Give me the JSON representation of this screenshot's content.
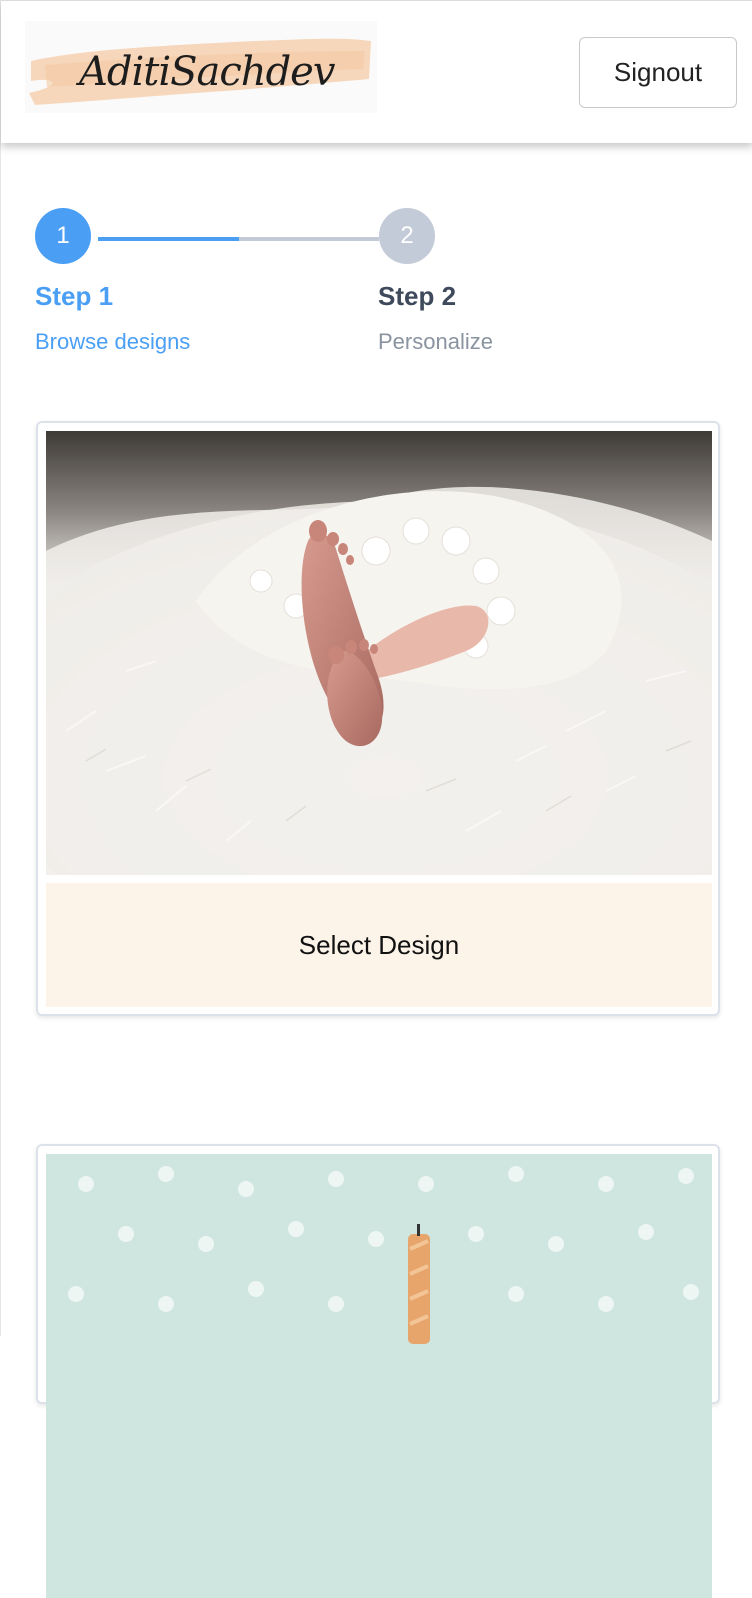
{
  "header": {
    "logo_text": "AditiSachdev",
    "signout_label": "Signout"
  },
  "stepper": {
    "steps": [
      {
        "number": "1",
        "title": "Step 1",
        "subtitle": "Browse designs",
        "state": "active"
      },
      {
        "number": "2",
        "title": "Step 2",
        "subtitle": "Personalize",
        "state": "inactive"
      }
    ],
    "active_color": "#4a9ff5",
    "inactive_color": "#c3cbd8"
  },
  "designs": [
    {
      "image": "newborn-feet-on-white-fur",
      "button_label": "Select Design"
    },
    {
      "image": "birthday-candle-on-mint-polka-dots"
    }
  ],
  "colors": {
    "select_button_bg": "#fcf3e9",
    "logo_brush": "#f6d3b4"
  }
}
